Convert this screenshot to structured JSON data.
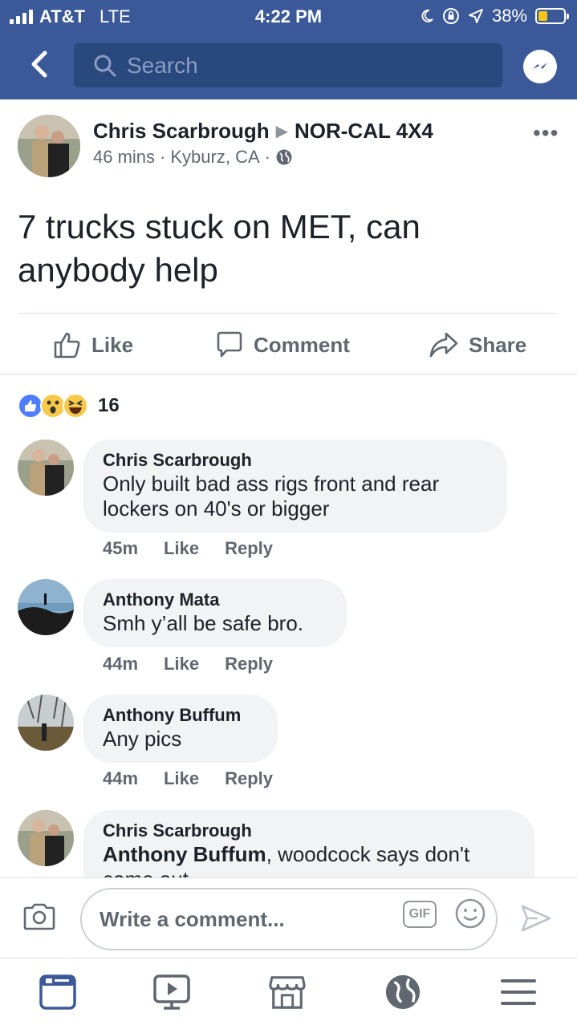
{
  "status_bar": {
    "carrier": "AT&T",
    "network": "LTE",
    "time": "4:22 PM",
    "battery_percent": "38%",
    "battery_level": 0.38
  },
  "nav": {
    "search_placeholder": "Search"
  },
  "post": {
    "author": "Chris Scarbrough",
    "group": "NOR-CAL 4X4",
    "time": "46 mins",
    "location": "Kyburz, CA",
    "text": "7 trucks stuck on MET,  can anybody help",
    "actions": {
      "like": "Like",
      "comment": "Comment",
      "share": "Share"
    },
    "reaction_count": "16"
  },
  "comments": [
    {
      "name": "Chris Scarbrough",
      "text": "Only built bad ass rigs front and rear lockers on 40's or bigger",
      "time": "45m",
      "like": "Like",
      "reply": "Reply"
    },
    {
      "name": "Anthony Mata",
      "text": "Smh y’all be safe bro.",
      "time": "44m",
      "like": "Like",
      "reply": "Reply"
    },
    {
      "name": "Anthony Buffum",
      "text": "Any pics",
      "time": "44m",
      "like": "Like",
      "reply": "Reply"
    },
    {
      "name": "Chris Scarbrough",
      "mention": "Anthony Buffum",
      "text": ", woodcock says don't come out"
    }
  ],
  "composer": {
    "placeholder": "Write a comment...",
    "gif_label": "GIF"
  },
  "colors": {
    "brand": "#3b5998",
    "search_bg": "#29487d",
    "bubble_bg": "#f2f3f5",
    "meta_text": "#606770",
    "battery": "#f5c518"
  },
  "icons": [
    "back-chevron-icon",
    "search-icon",
    "messenger-icon",
    "more-dots-icon",
    "globe-icon",
    "like-thumb-icon",
    "comment-icon",
    "share-icon",
    "camera-icon",
    "smiley-icon",
    "send-icon",
    "news-feed-icon",
    "watch-icon",
    "marketplace-icon",
    "notifications-globe-icon",
    "menu-icon"
  ]
}
